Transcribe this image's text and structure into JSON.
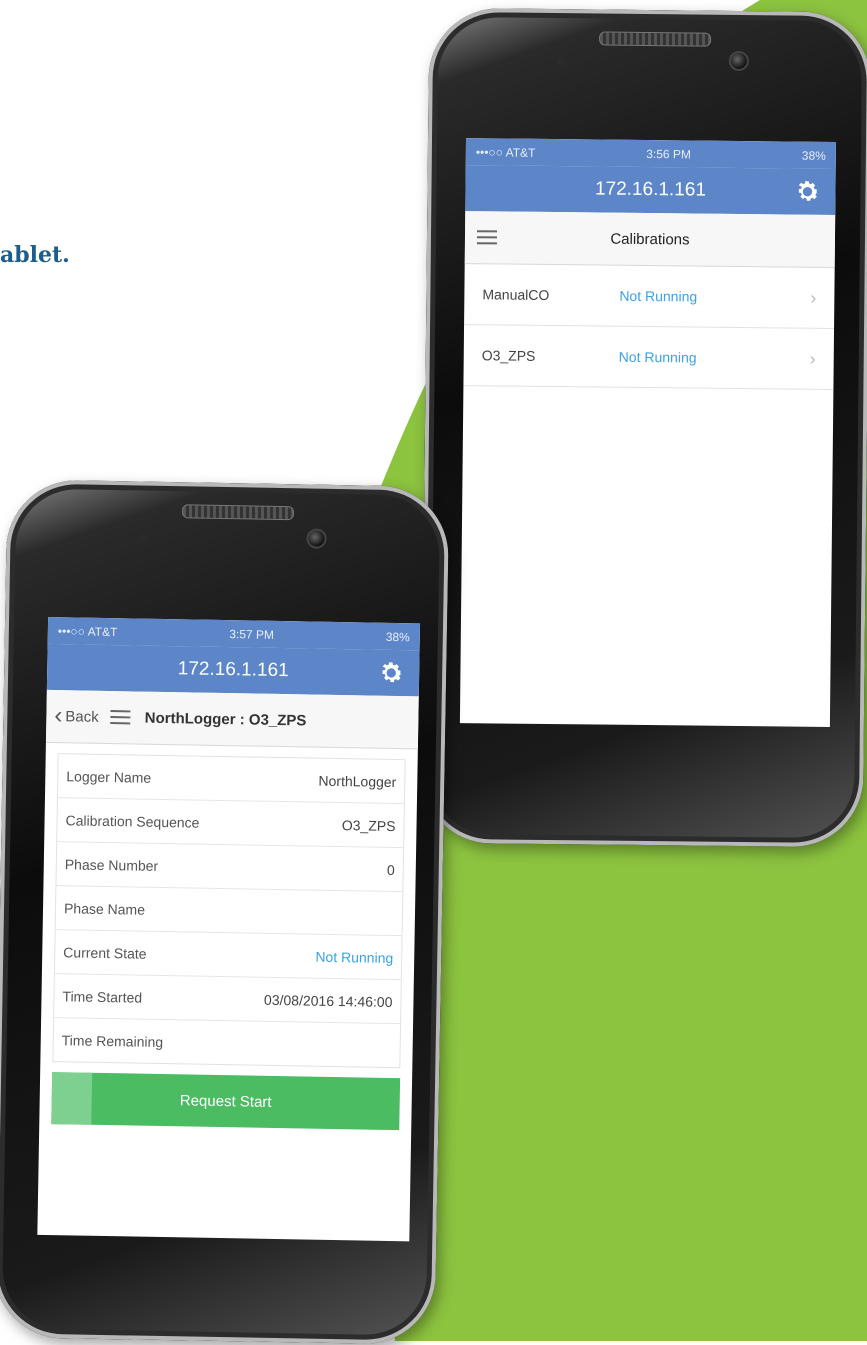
{
  "fragment_text": "ablet.",
  "colors": {
    "green_bg": "#8cc33f",
    "header_blue": "#5d86c9",
    "link_blue": "#3aa3e3",
    "button_green": "#4cbc63"
  },
  "phone_back": {
    "status": {
      "carrier": "•••○○ AT&T",
      "time": "3:56 PM",
      "battery": "38%"
    },
    "title": "172.16.1.161",
    "nav_title": "Calibrations",
    "calibrations": [
      {
        "name": "ManualCO",
        "status": "Not Running"
      },
      {
        "name": "O3_ZPS",
        "status": "Not Running"
      }
    ]
  },
  "phone_front": {
    "status": {
      "carrier": "•••○○ AT&T",
      "time": "3:57 PM",
      "battery": "38%"
    },
    "title": "172.16.1.161",
    "back_label": "Back",
    "nav_title": "NorthLogger : O3_ZPS",
    "details": [
      {
        "label": "Logger Name",
        "value": "NorthLogger"
      },
      {
        "label": "Calibration Sequence",
        "value": "O3_ZPS"
      },
      {
        "label": "Phase Number",
        "value": "0"
      },
      {
        "label": "Phase Name",
        "value": ""
      },
      {
        "label": "Current State",
        "value": "Not Running"
      },
      {
        "label": "Time Started",
        "value": "03/08/2016 14:46:00"
      },
      {
        "label": "Time Remaining",
        "value": ""
      }
    ],
    "button_label": "Request Start"
  }
}
